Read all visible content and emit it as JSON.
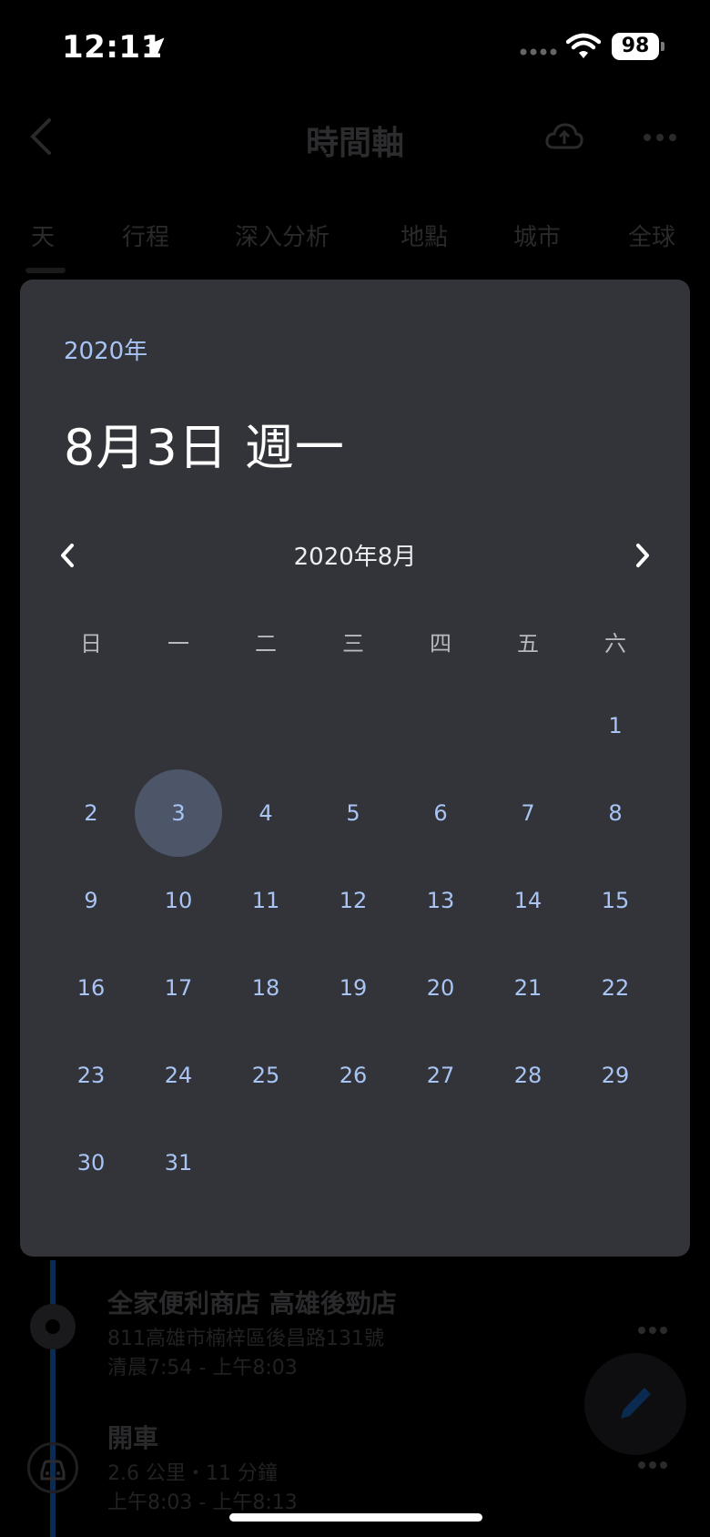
{
  "status": {
    "time": "12:11",
    "battery": "98"
  },
  "nav": {
    "title": "時間軸"
  },
  "tabs": [
    "天",
    "行程",
    "深入分析",
    "地點",
    "城市",
    "全球"
  ],
  "timeline": {
    "place": {
      "title": "全家便利商店 高雄後勁店",
      "address": "811高雄市楠梓區後昌路131號",
      "time": "清晨7:54 - 上午8:03"
    },
    "drive": {
      "title": "開車",
      "distance": "2.6 公里・11 分鐘",
      "time": "上午8:03 - 上午8:13"
    }
  },
  "dialog": {
    "year": "2020年",
    "selected_date": "8月3日 週一",
    "month_label": "2020年8月",
    "weekdays": [
      "日",
      "一",
      "二",
      "三",
      "四",
      "五",
      "六"
    ],
    "first_weekday_index": 6,
    "days_in_month": 31,
    "selected_day": 3
  },
  "colors": {
    "dialog_bg": "#333439",
    "accent": "#a8c4f4",
    "selected_bg": "#4d5568"
  }
}
